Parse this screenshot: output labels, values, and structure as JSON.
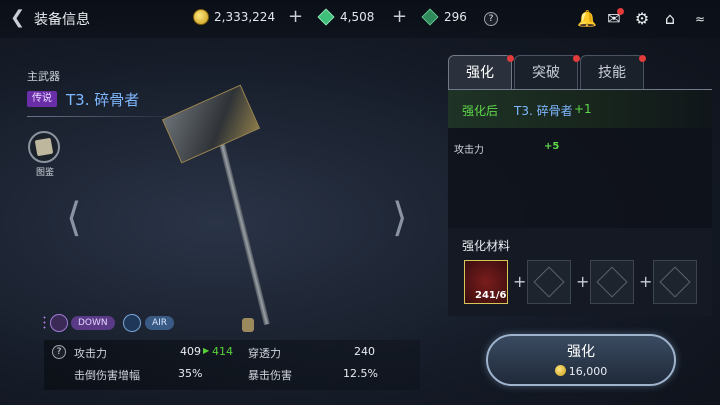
{
  "header": {
    "back_icon": "chevron-left-icon",
    "title": "装备信息",
    "gold": "2,333,224",
    "gems": "4,508",
    "tokens": "296",
    "help": "?"
  },
  "weapon": {
    "slot_label": "主武器",
    "rarity": "传说",
    "name": "T3. 碎骨者",
    "codex_label": "图鉴",
    "tags": [
      "DOWN",
      "AIR"
    ]
  },
  "stats": {
    "help": "?",
    "atk_label": "攻击力",
    "atk_value": "409",
    "atk_new": "414",
    "pierce_label": "穿透力",
    "pierce_value": "240",
    "knock_label": "击倒伤害增幅",
    "knock_value": "35%",
    "crit_label": "暴击伤害",
    "crit_value": "12.5%"
  },
  "tabs": [
    {
      "label": "强化",
      "active": true
    },
    {
      "label": "突破",
      "active": false
    },
    {
      "label": "技能",
      "active": false
    }
  ],
  "enhance": {
    "after_label": "强化后",
    "after_name": "T3. 碎骨者",
    "after_plus": "+1",
    "atk_label": "攻击力",
    "atk_gain": "+5",
    "materials_label": "强化材料",
    "material_count": "241/6",
    "button_label": "强化",
    "cost": "16,000"
  },
  "colors": {
    "accent_green": "#57d13a",
    "name_blue": "#7fb8ff",
    "legend_purple": "#6a2fa8",
    "notice_red": "#e23b3b"
  }
}
